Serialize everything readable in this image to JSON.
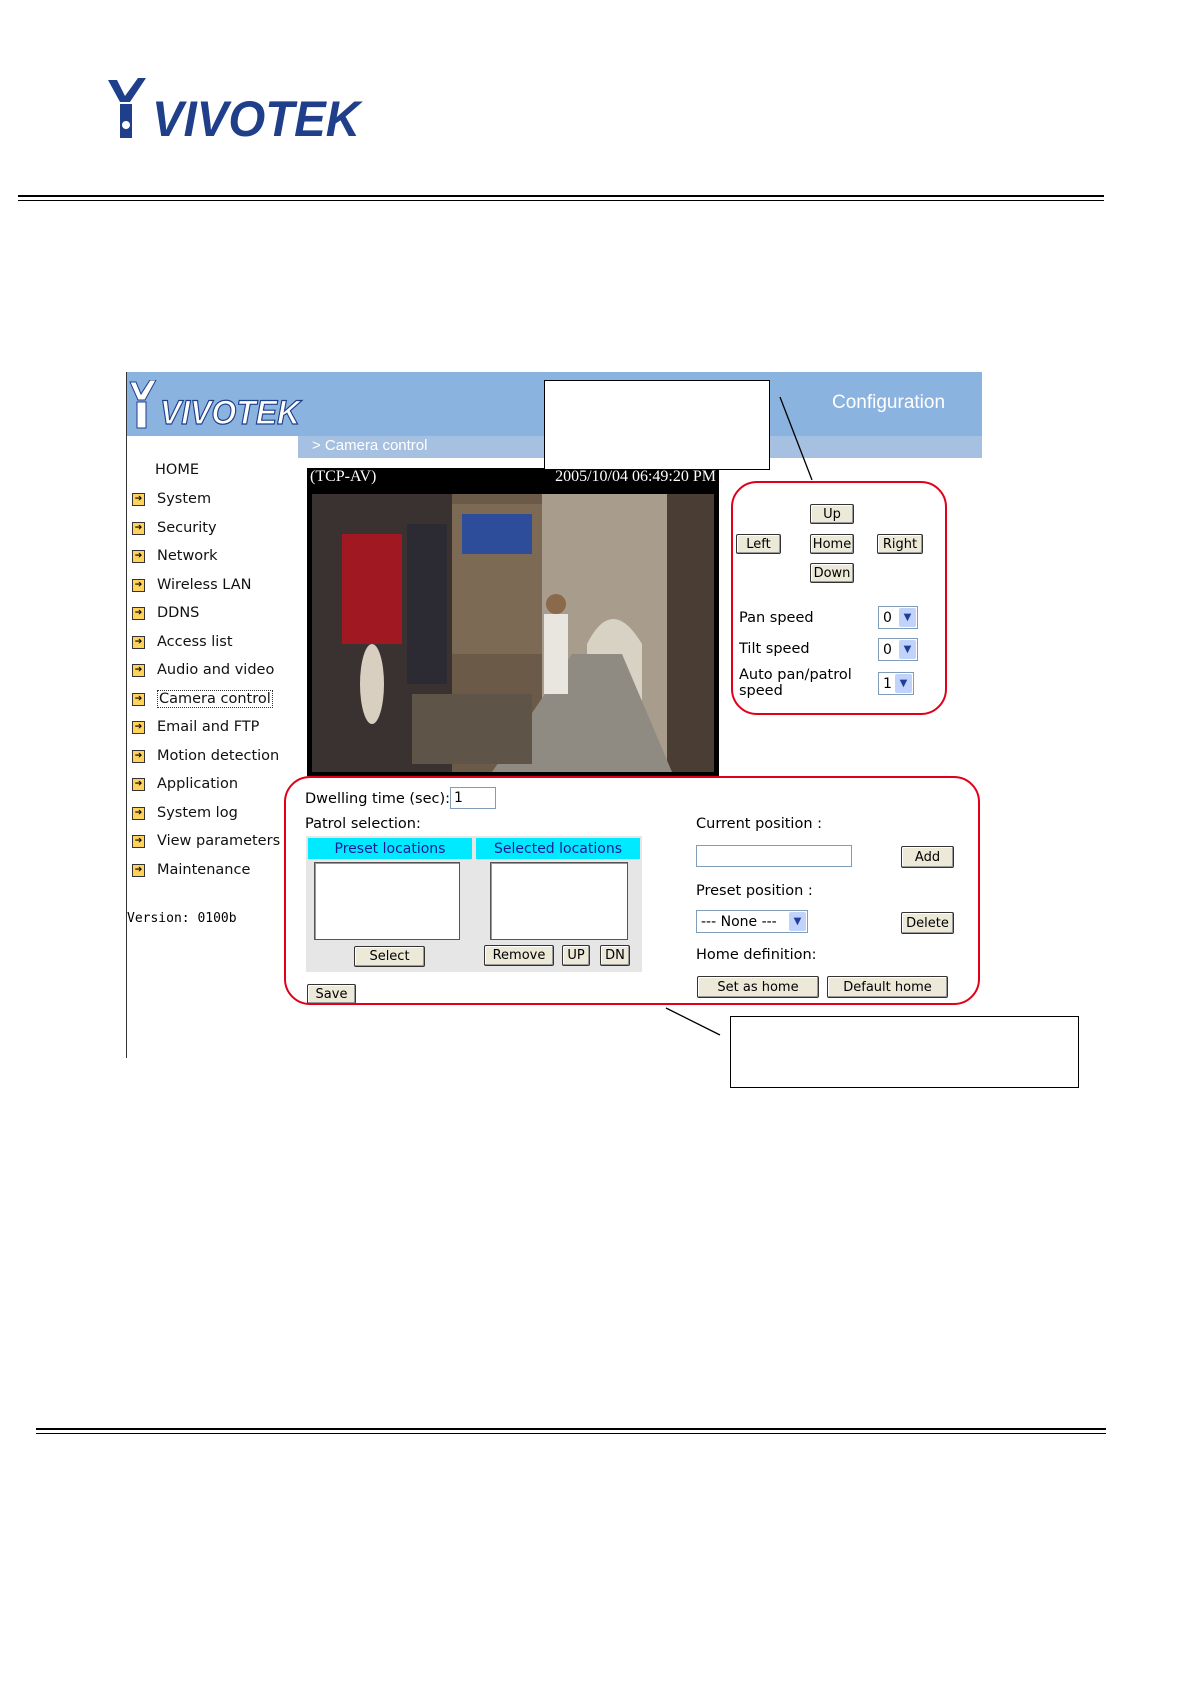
{
  "page": {
    "brand_logo_text": "VIVOTEK"
  },
  "app": {
    "logo_text": "VIVOTEK",
    "title": "Configuration",
    "breadcrumb": "> Camera control",
    "version": "Version: 0100b"
  },
  "sidebar": {
    "items": [
      {
        "label": "HOME",
        "icon": "none"
      },
      {
        "label": "System",
        "icon": "arrow-right-icon"
      },
      {
        "label": "Security",
        "icon": "arrow-right-icon"
      },
      {
        "label": "Network",
        "icon": "arrow-right-icon"
      },
      {
        "label": "Wireless LAN",
        "icon": "arrow-right-icon"
      },
      {
        "label": "DDNS",
        "icon": "arrow-right-icon"
      },
      {
        "label": "Access list",
        "icon": "arrow-right-icon"
      },
      {
        "label": "Audio and video",
        "icon": "arrow-right-icon"
      },
      {
        "label": "Camera control",
        "icon": "arrow-right-icon",
        "selected": true
      },
      {
        "label": "Email and FTP",
        "icon": "arrow-right-icon"
      },
      {
        "label": "Motion detection",
        "icon": "arrow-right-icon"
      },
      {
        "label": "Application",
        "icon": "arrow-right-icon"
      },
      {
        "label": "System log",
        "icon": "arrow-right-icon"
      },
      {
        "label": "View parameters",
        "icon": "arrow-right-icon"
      },
      {
        "label": "Maintenance",
        "icon": "arrow-right-icon"
      }
    ]
  },
  "video": {
    "protocol": "(TCP-AV)",
    "timestamp": "2005/10/04 06:49:20 PM"
  },
  "ptz": {
    "up": "Up",
    "left": "Left",
    "home": "Home",
    "right": "Right",
    "down": "Down",
    "pan_speed_label": "Pan speed",
    "pan_speed_value": "0",
    "tilt_speed_label": "Tilt speed",
    "tilt_speed_value": "0",
    "auto_pan_label_1": "Auto pan/patrol",
    "auto_pan_label_2": "speed",
    "auto_pan_value": "1"
  },
  "patrol": {
    "dwelling_label": "Dwelling time (sec):",
    "dwelling_value": "1",
    "selection_label": "Patrol selection:",
    "preset_header": "Preset locations",
    "selected_header": "Selected locations",
    "select_btn": "Select",
    "remove_btn": "Remove",
    "up_btn": "UP",
    "dn_btn": "DN",
    "save_btn": "Save"
  },
  "position": {
    "current_label": "Current position :",
    "current_value": "",
    "add_btn": "Add",
    "preset_label": "Preset position :",
    "preset_value": "--- None ---",
    "delete_btn": "Delete",
    "home_def_label": "Home definition:",
    "set_home_btn": "Set as home",
    "default_home_btn": "Default home"
  },
  "colors": {
    "header_blue": "#8bb3df",
    "annotation_red": "#e0001a",
    "list_header_cyan": "#00eaff"
  }
}
